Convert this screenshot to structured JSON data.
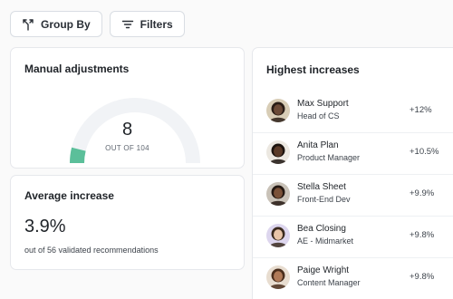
{
  "toolbar": {
    "group_by_label": "Group By",
    "filters_label": "Filters"
  },
  "manual_adjustments": {
    "title": "Manual adjustments",
    "value": "8",
    "subtitle": "OUT OF 104",
    "progress_fraction": 0.077,
    "accent_color": "#5bbf9a",
    "track_color": "#f1f3f6"
  },
  "average_increase": {
    "title": "Average increase",
    "value": "3.9%",
    "subtitle": "out of 56 validated recommendations"
  },
  "highest_increases": {
    "title": "Highest increases",
    "people": [
      {
        "name": "Max Support",
        "role": "Head of CS",
        "change": "+12%",
        "avatar_bg": "#d8cdb6",
        "skin": "#6b4a37",
        "hair": "#2a1d16"
      },
      {
        "name": "Anita Plan",
        "role": "Product Manager",
        "change": "+10.5%",
        "avatar_bg": "#ece8e1",
        "skin": "#5a3a28",
        "hair": "#1c130e"
      },
      {
        "name": "Stella Sheet",
        "role": "Front-End Dev",
        "change": "+9.9%",
        "avatar_bg": "#c9c2b8",
        "skin": "#7a5138",
        "hair": "#241812"
      },
      {
        "name": "Bea Closing",
        "role": "AE - Midmarket",
        "change": "+9.8%",
        "avatar_bg": "#ddd6ee",
        "skin": "#e8c4a8",
        "hair": "#3a2a1e"
      },
      {
        "name": "Paige Wright",
        "role": "Content Manager",
        "change": "+9.8%",
        "avatar_bg": "#e8ddd0",
        "skin": "#b07a58",
        "hair": "#4a2e1c"
      }
    ]
  }
}
